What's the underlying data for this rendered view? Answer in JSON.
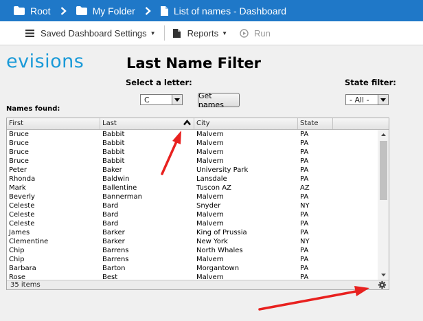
{
  "breadcrumb": {
    "items": [
      {
        "label": "Root",
        "icon": "folder-icon"
      },
      {
        "label": "My Folder",
        "icon": "folder-icon"
      },
      {
        "label": "List of names - Dashboard",
        "icon": "document-icon"
      }
    ]
  },
  "toolbar": {
    "saved_settings_label": "Saved Dashboard Settings",
    "reports_label": "Reports",
    "run_label": "Run"
  },
  "logo_text": "evisions",
  "page_title": "Last Name Filter",
  "letter_filter": {
    "label": "Select a letter:",
    "value": "C"
  },
  "get_names_label": "Get names",
  "state_filter": {
    "label": "State filter:",
    "value": "- All -"
  },
  "names_found_label": "Names found:",
  "grid": {
    "columns": [
      "First",
      "Last",
      "City",
      "State"
    ],
    "sorted_column": "Last",
    "sort_direction": "ascending",
    "rows": [
      [
        "Bruce",
        "Babbit",
        "Malvern",
        "PA"
      ],
      [
        "Bruce",
        "Babbit",
        "Malvern",
        "PA"
      ],
      [
        "Bruce",
        "Babbit",
        "Malvern",
        "PA"
      ],
      [
        "Bruce",
        "Babbit",
        "Malvern",
        "PA"
      ],
      [
        "Peter",
        "Baker",
        "University Park",
        "PA"
      ],
      [
        "Rhonda",
        "Baldwin",
        "Lansdale",
        "PA"
      ],
      [
        "Mark",
        "Ballentine",
        "Tuscon AZ",
        "AZ"
      ],
      [
        "Beverly",
        "Bannerman",
        "Malvern",
        "PA"
      ],
      [
        "Celeste",
        "Bard",
        "Snyder",
        "NY"
      ],
      [
        "Celeste",
        "Bard",
        "Malvern",
        "PA"
      ],
      [
        "Celeste",
        "Bard",
        "Malvern",
        "PA"
      ],
      [
        "James",
        "Barker",
        "King of Prussia",
        "PA"
      ],
      [
        "Clementine",
        "Barker",
        "New York",
        "NY"
      ],
      [
        "Chip",
        "Barrens",
        "North Whales",
        "PA"
      ],
      [
        "Chip",
        "Barrens",
        "Malvern",
        "PA"
      ],
      [
        "Barbara",
        "Barton",
        "Morgantown",
        "PA"
      ],
      [
        "Rose",
        "Best",
        "Malvern",
        "PA"
      ]
    ],
    "footer_count": "35 items"
  },
  "colors": {
    "topbar": "#1f78c8",
    "logo": "#1a9ad8",
    "annotation_arrow": "#e8211f"
  }
}
